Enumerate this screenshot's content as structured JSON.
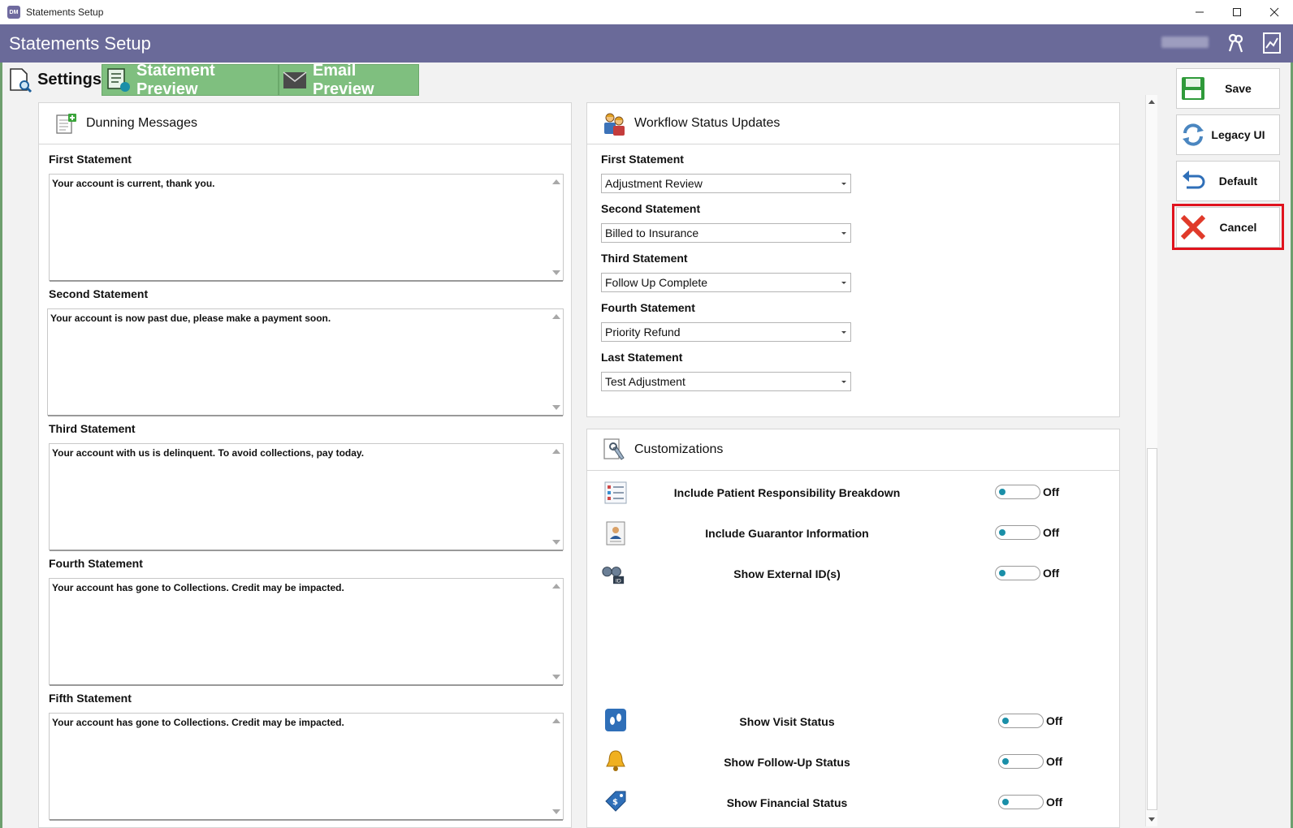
{
  "window": {
    "title": "Statements Setup"
  },
  "header": {
    "app_title": "Statements Setup"
  },
  "tabs": [
    {
      "label": "Settings",
      "active": true
    },
    {
      "label": "Statement Preview",
      "active": false
    },
    {
      "label": "Email Preview",
      "active": false
    }
  ],
  "dunning": {
    "title": "Dunning Messages",
    "statements": [
      {
        "label": "First Statement",
        "message": "Your account is current, thank you."
      },
      {
        "label": "Second Statement",
        "message": "Your account is now past due, please make a payment soon."
      },
      {
        "label": "Third Statement",
        "message": "Your account with us is delinquent. To avoid collections, pay today."
      },
      {
        "label": "Fourth Statement",
        "message": "Your account has gone to Collections. Credit may be impacted."
      },
      {
        "label": "Fifth Statement",
        "message": "Your account has gone to Collections. Credit may be impacted."
      }
    ]
  },
  "workflow": {
    "title": "Workflow Status Updates",
    "items": [
      {
        "label": "First Statement",
        "value": "Adjustment Review"
      },
      {
        "label": "Second Statement",
        "value": "Billed to Insurance"
      },
      {
        "label": "Third Statement",
        "value": "Follow Up Complete"
      },
      {
        "label": "Fourth Statement",
        "value": "Priority Refund"
      },
      {
        "label": "Last Statement",
        "value": "Test Adjustment"
      }
    ]
  },
  "customizations": {
    "title": "Customizations",
    "items": [
      {
        "label": "Include Patient Responsibility Breakdown",
        "state": "Off",
        "icon": "list-icon"
      },
      {
        "label": "Include Guarantor Information",
        "state": "Off",
        "icon": "id-card-icon"
      },
      {
        "label": "Show External ID(s)",
        "state": "Off",
        "icon": "binoculars-id-icon"
      },
      {
        "label": "Show Visit Status",
        "state": "Off",
        "icon": "footprints-icon"
      },
      {
        "label": "Show Follow-Up Status",
        "state": "Off",
        "icon": "bell-icon"
      },
      {
        "label": "Show Financial Status",
        "state": "Off",
        "icon": "price-tag-icon"
      }
    ]
  },
  "actions": {
    "save": "Save",
    "legacy": "Legacy UI",
    "default": "Default",
    "cancel": "Cancel"
  },
  "colors": {
    "header": "#6a6a99",
    "tab_inactive": "#7fbf7f",
    "toggle_knob": "#1a8fa8",
    "highlight": "#e0131e"
  }
}
